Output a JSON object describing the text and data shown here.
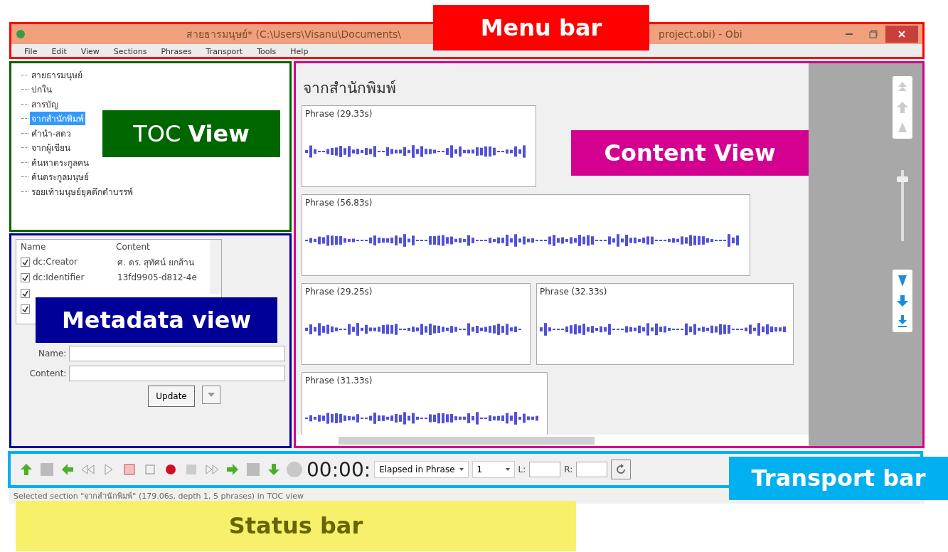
{
  "window": {
    "title_parts": [
      "สายธารมนุษย์* (C:\\Users\\Visanu\\Documents\\",
      "project.obi) - Obi"
    ]
  },
  "menu": [
    "File",
    "Edit",
    "View",
    "Sections",
    "Phrases",
    "Transport",
    "Tools",
    "Help"
  ],
  "toc": {
    "items": [
      {
        "label": "สายธารมนุษย์",
        "selected": false
      },
      {
        "label": "ปกใน",
        "selected": false
      },
      {
        "label": "สารบัญ",
        "selected": false
      },
      {
        "label": "จากสำนักพิมพ์",
        "selected": true
      },
      {
        "label": "คำนำ-สดว",
        "selected": false
      },
      {
        "label": "จากผู้เขียน",
        "selected": false
      },
      {
        "label": "ค้นหาตระกูลคน",
        "selected": false
      },
      {
        "label": "ค้นตระกูลมนุษย์",
        "selected": false
      },
      {
        "label": "รอยเท้ามนุษย์ยุคดึกดำบรรพ์",
        "selected": false
      }
    ]
  },
  "metadata": {
    "columns": [
      "Name",
      "Content"
    ],
    "rows": [
      {
        "name": "dc:Creator",
        "content": "ศ. ดร. สุทัศน์ ยกส้าน",
        "checked": true
      },
      {
        "name": "dc:Identifier",
        "content": "13fd9905-d812-4e",
        "checked": true
      },
      {
        "checked": true
      },
      {
        "checked": true
      }
    ],
    "name_label": "Name:",
    "content_label": "Content:",
    "update_button": "Update"
  },
  "content": {
    "heading": "จากสำนักพิมพ์",
    "phrases": [
      {
        "label": "Phrase (29.33s)"
      },
      {
        "label": "Phrase (56.83s)"
      },
      {
        "label": "Phrase (29.25s)"
      },
      {
        "label": "Phrase (32.33s)"
      },
      {
        "label": "Phrase (31.33s)"
      }
    ],
    "zoom_slider": {
      "level": 0.9
    }
  },
  "transport": {
    "time": "00:00:",
    "time_mode": "Elapsed in Phrase",
    "step": "1",
    "l_label": "L:",
    "r_label": "R:"
  },
  "status_bar": "Selected section \"จากสำนักพิมพ์\" (179.06s, depth 1, 5 phrases) in TOC view",
  "annotations": [
    {
      "label": "Menu bar",
      "color": "#ff0000",
      "kind": "bold"
    },
    {
      "label": "TOC **View**",
      "color": "#006600",
      "kind": "mixed"
    },
    {
      "label": "Content View",
      "color": "#d4008f",
      "kind": "bold"
    },
    {
      "label": "Metadata view",
      "color": "#000099",
      "kind": "bold"
    },
    {
      "label": "Transport bar",
      "color": "#00b0f0",
      "kind": "bold"
    },
    {
      "label": "Status bar",
      "color": "#f7f06a",
      "kind": "bold"
    }
  ]
}
